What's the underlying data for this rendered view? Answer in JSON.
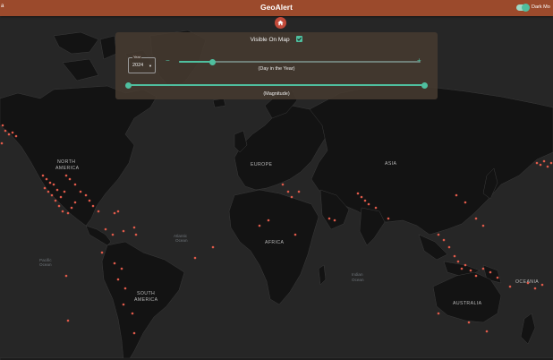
{
  "app": {
    "title": "GeoAlert",
    "left_label": "a",
    "dark_mode_label": "Dark Mo",
    "dark_mode_on": true
  },
  "filter": {
    "visible_label": "Visible On Map",
    "visible_checked": true,
    "year_legend": "Year",
    "year_value": "2024",
    "minus_label": "−",
    "plus_label": "+",
    "day_caption": "(Day in the Year)",
    "day_fraction": 0.14,
    "magnitude_caption": "(Magnitude)",
    "magnitude_range": [
      0.0,
      1.0
    ]
  },
  "map": {
    "continent_labels": {
      "na1": "NORTH",
      "na2": "AMERICA",
      "sa1": "SOUTH",
      "sa2": "AMERICA",
      "europe": "EUROPE",
      "asia": "ASIA",
      "africa": "AFRICA",
      "australia": "AUSTRALIA",
      "oceania": "OCEANIA"
    },
    "ocean_labels": {
      "pac1": "Pacific",
      "pac2": "Ocean",
      "atl1": "Atlantic",
      "atl2": "Ocean",
      "ind1": "Indian",
      "ind2": "Ocean"
    },
    "marker_color": "#e05a4a",
    "land_color": "#121212",
    "water_color": "#262626"
  }
}
